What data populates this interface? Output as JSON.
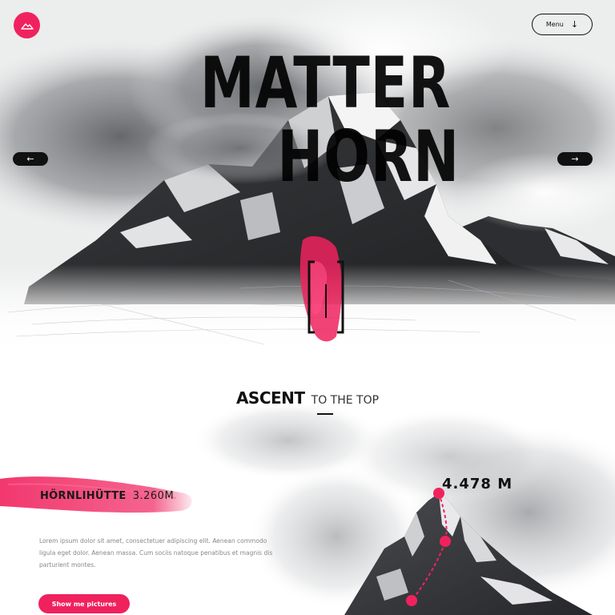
{
  "header": {
    "logo_icon": "mountain-icon",
    "menu_label": "Menu",
    "menu_icon": "arrow-down-icon"
  },
  "hero": {
    "title_line1": "MATTER",
    "title_line2": "HORN",
    "prev_icon": "arrow-left-icon",
    "next_icon": "arrow-right-icon",
    "center_icon": "brackets-icon"
  },
  "ascent": {
    "title_strong": "ASCENT",
    "title_light": "TO THE TOP",
    "waypoint_name": "HÖRNLIHÜTTE",
    "waypoint_altitude": "3.260M",
    "description": "Lorem ipsum dolor sit amet, consectetuer adipiscing elit. Aenean commodo ligula eget dolor. Aenean massa. Cum sociis natoque penatibus et magnis dis parturient montes.",
    "button_label": "Show me pictures",
    "summit_altitude": "4.478 M"
  },
  "colors": {
    "accent": "#f0225e",
    "text_dark": "#111111",
    "text_muted": "#888888"
  }
}
